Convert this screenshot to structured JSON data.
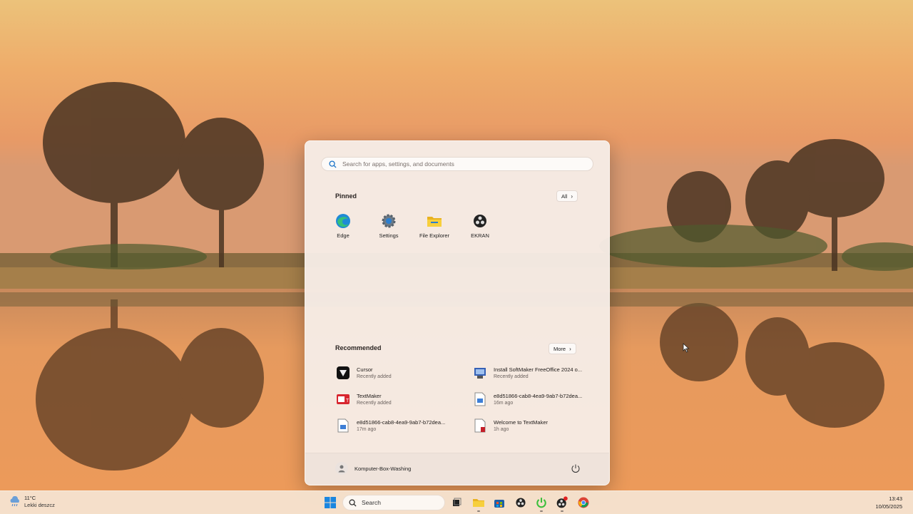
{
  "desktop": {
    "wallpaper": "sunset lake with trees reflection"
  },
  "start_menu": {
    "search_placeholder": "Search for apps, settings, and documents",
    "pinned_title": "Pinned",
    "all_button": "All",
    "pinned_apps": [
      {
        "label": "Edge",
        "icon": "edge-icon"
      },
      {
        "label": "Settings",
        "icon": "settings-gear-icon"
      },
      {
        "label": "File Explorer",
        "icon": "folder-icon"
      },
      {
        "label": "EKRAN",
        "icon": "obs-icon"
      }
    ],
    "recommended_title": "Recommended",
    "more_button": "More",
    "recommended": [
      {
        "title": "Cursor",
        "sub": "Recently added",
        "icon": "cursor-app-icon"
      },
      {
        "title": "Install SoftMaker FreeOffice 2024 o...",
        "sub": "Recently added",
        "icon": "installer-icon"
      },
      {
        "title": "TextMaker",
        "sub": "Recently added",
        "icon": "textmaker-icon"
      },
      {
        "title": "e8d51866-cab8-4ea9-9ab7-b72dea...",
        "sub": "16m ago",
        "icon": "image-file-icon"
      },
      {
        "title": "e8d51866-cab8-4ea9-9ab7-b72dea...",
        "sub": "17m ago",
        "icon": "image-file-icon"
      },
      {
        "title": "Welcome to TextMaker",
        "sub": "1h ago",
        "icon": "document-icon"
      }
    ],
    "user_name": "Komputer-Box-Washing"
  },
  "taskbar": {
    "weather_temp": "11°C",
    "weather_desc": "Lekki deszcz",
    "search_label": "Search",
    "time": "13:43",
    "date": "10/05/2025"
  }
}
